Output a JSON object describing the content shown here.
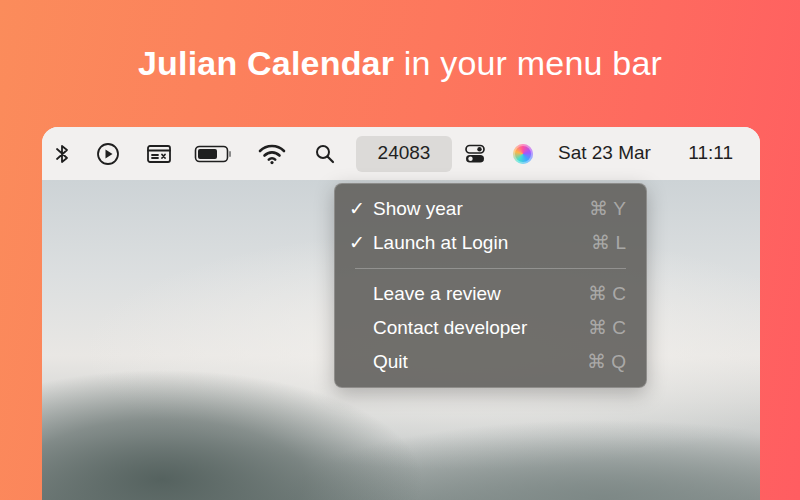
{
  "headline": {
    "bold": "Julian Calendar",
    "rest": "in your menu bar"
  },
  "menu_bar": {
    "status_item": {
      "label": "24083",
      "selected": true
    },
    "date": "Sat 23 Mar",
    "time": "11:11"
  },
  "menu": {
    "check_mark": "✓",
    "items": [
      {
        "kind": "item",
        "checked": true,
        "label": "Show year",
        "shortcut": "⌘ Y"
      },
      {
        "kind": "item",
        "checked": true,
        "label": "Launch at Login",
        "shortcut": "⌘ L"
      },
      {
        "kind": "separator"
      },
      {
        "kind": "item",
        "checked": false,
        "label": "Leave a review",
        "shortcut": "⌘ C"
      },
      {
        "kind": "item",
        "checked": false,
        "label": "Contact developer",
        "shortcut": "⌘ C"
      },
      {
        "kind": "item",
        "checked": false,
        "label": "Quit",
        "shortcut": "⌘ Q"
      }
    ]
  }
}
